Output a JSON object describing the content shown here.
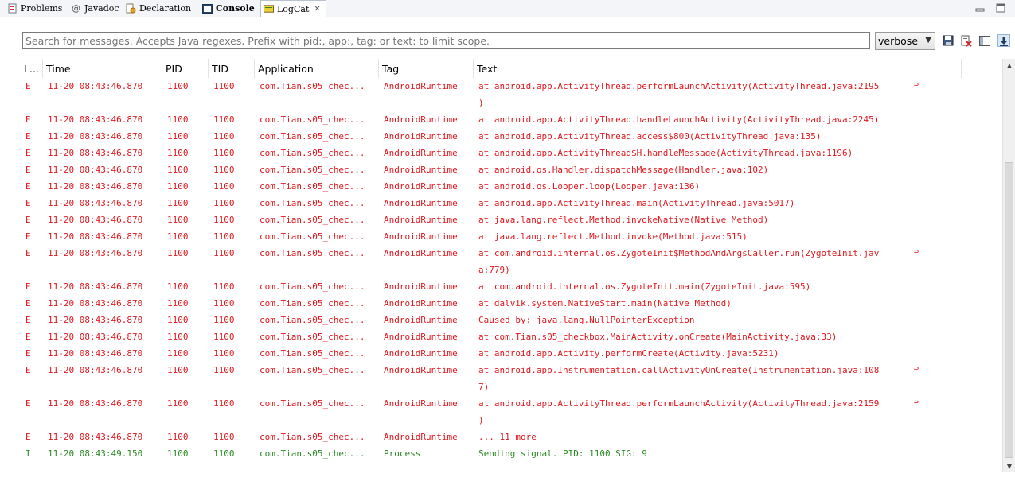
{
  "tabs": [
    {
      "label": "Problems",
      "icon": "problems-icon",
      "active": false
    },
    {
      "label": "Javadoc",
      "icon": "at-icon",
      "active": false
    },
    {
      "label": "Declaration",
      "icon": "declaration-icon",
      "active": false
    },
    {
      "label": "Console",
      "icon": "console-icon",
      "active": false
    },
    {
      "label": "LogCat",
      "icon": "logcat-icon",
      "active": true,
      "close": "✕"
    }
  ],
  "filter": {
    "placeholder": "Search for messages. Accepts Java regexes. Prefix with pid:, app:, tag: or text: to limit scope.",
    "level": "verbose",
    "tools": [
      "save-icon",
      "clear-log-icon",
      "toggle-filters-icon",
      "scroll-lock-icon"
    ]
  },
  "columns": [
    "L...",
    "Time",
    "PID",
    "TID",
    "Application",
    "Tag",
    "Text"
  ],
  "colors": {
    "error": "#e0191f",
    "info": "#2a8a23"
  },
  "rows": [
    {
      "level": "E",
      "time": "11-20 08:43:46.870",
      "pid": "1100",
      "tid": "1100",
      "app": "com.Tian.s05_chec...",
      "tag": "AndroidRuntime",
      "text": "at android.app.ActivityThread.performLaunchActivity(ActivityThread.java:2195)",
      "wrap_line1": "at android.app.ActivityThread.performLaunchActivity(ActivityThread.java:2195",
      "wrap_line2": ")"
    },
    {
      "level": "E",
      "time": "11-20 08:43:46.870",
      "pid": "1100",
      "tid": "1100",
      "app": "com.Tian.s05_chec...",
      "tag": "AndroidRuntime",
      "text": "at android.app.ActivityThread.handleLaunchActivity(ActivityThread.java:2245)"
    },
    {
      "level": "E",
      "time": "11-20 08:43:46.870",
      "pid": "1100",
      "tid": "1100",
      "app": "com.Tian.s05_chec...",
      "tag": "AndroidRuntime",
      "text": "at android.app.ActivityThread.access$800(ActivityThread.java:135)"
    },
    {
      "level": "E",
      "time": "11-20 08:43:46.870",
      "pid": "1100",
      "tid": "1100",
      "app": "com.Tian.s05_chec...",
      "tag": "AndroidRuntime",
      "text": "at android.app.ActivityThread$H.handleMessage(ActivityThread.java:1196)"
    },
    {
      "level": "E",
      "time": "11-20 08:43:46.870",
      "pid": "1100",
      "tid": "1100",
      "app": "com.Tian.s05_chec...",
      "tag": "AndroidRuntime",
      "text": "at android.os.Handler.dispatchMessage(Handler.java:102)"
    },
    {
      "level": "E",
      "time": "11-20 08:43:46.870",
      "pid": "1100",
      "tid": "1100",
      "app": "com.Tian.s05_chec...",
      "tag": "AndroidRuntime",
      "text": "at android.os.Looper.loop(Looper.java:136)"
    },
    {
      "level": "E",
      "time": "11-20 08:43:46.870",
      "pid": "1100",
      "tid": "1100",
      "app": "com.Tian.s05_chec...",
      "tag": "AndroidRuntime",
      "text": "at android.app.ActivityThread.main(ActivityThread.java:5017)"
    },
    {
      "level": "E",
      "time": "11-20 08:43:46.870",
      "pid": "1100",
      "tid": "1100",
      "app": "com.Tian.s05_chec...",
      "tag": "AndroidRuntime",
      "text": "at java.lang.reflect.Method.invokeNative(Native Method)"
    },
    {
      "level": "E",
      "time": "11-20 08:43:46.870",
      "pid": "1100",
      "tid": "1100",
      "app": "com.Tian.s05_chec...",
      "tag": "AndroidRuntime",
      "text": "at java.lang.reflect.Method.invoke(Method.java:515)"
    },
    {
      "level": "E",
      "time": "11-20 08:43:46.870",
      "pid": "1100",
      "tid": "1100",
      "app": "com.Tian.s05_chec...",
      "tag": "AndroidRuntime",
      "text": "at com.android.internal.os.ZygoteInit$MethodAndArgsCaller.run(ZygoteInit.java:779)",
      "wrap_line1": "at com.android.internal.os.ZygoteInit$MethodAndArgsCaller.run(ZygoteInit.jav",
      "wrap_line2": "a:779)"
    },
    {
      "level": "E",
      "time": "11-20 08:43:46.870",
      "pid": "1100",
      "tid": "1100",
      "app": "com.Tian.s05_chec...",
      "tag": "AndroidRuntime",
      "text": "at com.android.internal.os.ZygoteInit.main(ZygoteInit.java:595)"
    },
    {
      "level": "E",
      "time": "11-20 08:43:46.870",
      "pid": "1100",
      "tid": "1100",
      "app": "com.Tian.s05_chec...",
      "tag": "AndroidRuntime",
      "text": "at dalvik.system.NativeStart.main(Native Method)"
    },
    {
      "level": "E",
      "time": "11-20 08:43:46.870",
      "pid": "1100",
      "tid": "1100",
      "app": "com.Tian.s05_chec...",
      "tag": "AndroidRuntime",
      "text": "Caused by: java.lang.NullPointerException"
    },
    {
      "level": "E",
      "time": "11-20 08:43:46.870",
      "pid": "1100",
      "tid": "1100",
      "app": "com.Tian.s05_chec...",
      "tag": "AndroidRuntime",
      "text": "at com.Tian.s05_checkbox.MainActivity.onCreate(MainActivity.java:33)"
    },
    {
      "level": "E",
      "time": "11-20 08:43:46.870",
      "pid": "1100",
      "tid": "1100",
      "app": "com.Tian.s05_chec...",
      "tag": "AndroidRuntime",
      "text": "at android.app.Activity.performCreate(Activity.java:5231)"
    },
    {
      "level": "E",
      "time": "11-20 08:43:46.870",
      "pid": "1100",
      "tid": "1100",
      "app": "com.Tian.s05_chec...",
      "tag": "AndroidRuntime",
      "text": "at android.app.Instrumentation.callActivityOnCreate(Instrumentation.java:1087)",
      "wrap_line1": "at android.app.Instrumentation.callActivityOnCreate(Instrumentation.java:108",
      "wrap_line2": "7)"
    },
    {
      "level": "E",
      "time": "11-20 08:43:46.870",
      "pid": "1100",
      "tid": "1100",
      "app": "com.Tian.s05_chec...",
      "tag": "AndroidRuntime",
      "text": "at android.app.ActivityThread.performLaunchActivity(ActivityThread.java:2159)",
      "wrap_line1": "at android.app.ActivityThread.performLaunchActivity(ActivityThread.java:2159",
      "wrap_line2": ")"
    },
    {
      "level": "E",
      "time": "11-20 08:43:46.870",
      "pid": "1100",
      "tid": "1100",
      "app": "com.Tian.s05_chec...",
      "tag": "AndroidRuntime",
      "text": "... 11 more"
    },
    {
      "level": "I",
      "time": "11-20 08:43:49.150",
      "pid": "1100",
      "tid": "1100",
      "app": "com.Tian.s05_chec...",
      "tag": "Process",
      "text": "Sending signal. PID: 1100 SIG: 9"
    }
  ]
}
